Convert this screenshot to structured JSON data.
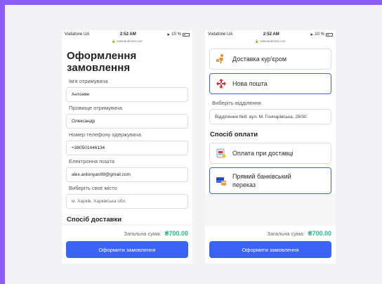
{
  "statusbar": {
    "carrier": "Vodafone UA",
    "time": "2:52 AM",
    "battery": "10 %"
  },
  "urlbar": {
    "host": "salesandchat.com"
  },
  "left": {
    "title": "Оформлення замовлення",
    "fields": [
      {
        "label": "Ім'я отримувача",
        "value": "Антонян"
      },
      {
        "label": "Прізвище отримувача",
        "value": "Олександр"
      },
      {
        "label": "Номер телефону одержувача",
        "value": "+380501446134"
      },
      {
        "label": "Електронна пошта",
        "value": "alex.antonyan99@gmail.com"
      },
      {
        "label": "Виберіть своє місто",
        "value": "м. Харків, Харківська обл."
      }
    ],
    "delivery_heading": "Спосіб доставки"
  },
  "right": {
    "delivery_options": [
      {
        "label": "Доставка кур'єром",
        "icon": "courier-icon"
      },
      {
        "label": "Нова пошта",
        "icon": "nova-poshta-icon"
      }
    ],
    "branch_label": "Виберіть відділення",
    "branch_value": "Відділення №8: вул. М. Гончарівська, 28/30",
    "payment_heading": "Спосіб оплати",
    "payment_options": [
      {
        "label": "Оплата при доставці",
        "icon": "cash-icon"
      },
      {
        "label_line1": "Прямий банківський",
        "label_line2": "переказ",
        "icon": "bank-card-icon"
      }
    ]
  },
  "summary": {
    "total_label": "Загальна сума:",
    "total_value": "₴700.00",
    "button_label": "Оформити замовлення"
  },
  "colors": {
    "accent": "#3b63f5",
    "total": "#2fb58d",
    "frame": "#8b5cf6"
  }
}
